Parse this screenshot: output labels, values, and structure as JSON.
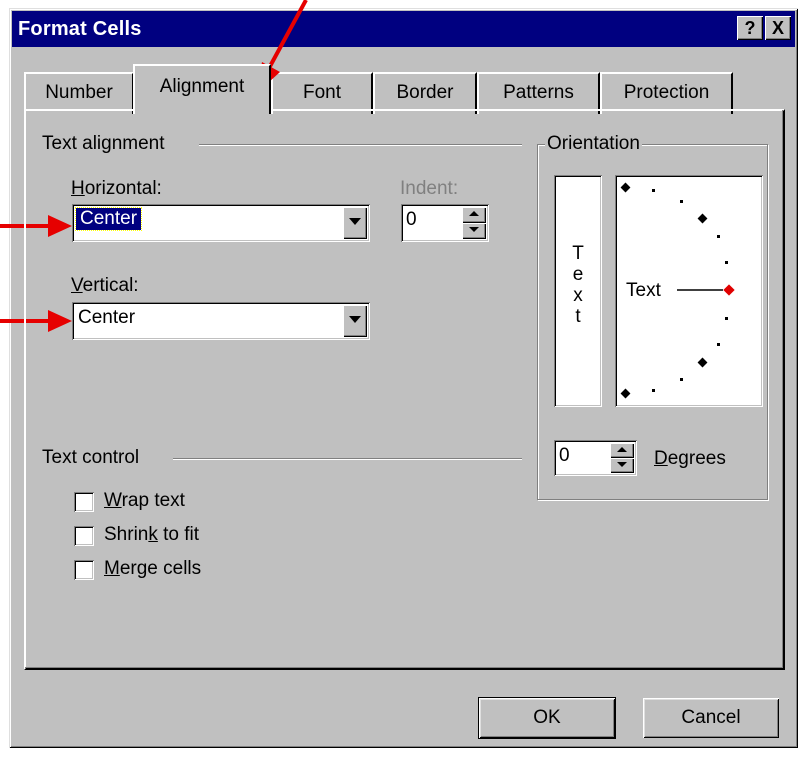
{
  "window": {
    "title": "Format Cells",
    "help_label": "?",
    "close_label": "X"
  },
  "tabs": [
    {
      "label": "Number"
    },
    {
      "label": "Alignment"
    },
    {
      "label": "Font"
    },
    {
      "label": "Border"
    },
    {
      "label": "Patterns"
    },
    {
      "label": "Protection"
    }
  ],
  "text_alignment": {
    "group_label": "Text alignment",
    "horizontal": {
      "label_first": "H",
      "label_rest": "orizontal:",
      "value": "Center"
    },
    "vertical": {
      "label_first": "V",
      "label_rest": "ertical:",
      "value": "Center"
    },
    "indent": {
      "label": "Indent:",
      "value": "0"
    }
  },
  "orientation": {
    "group_label": "Orientation",
    "vertical_text_letters": [
      "T",
      "e",
      "x",
      "t"
    ],
    "dial_text": "Text",
    "degrees_value": "0",
    "degrees_label_first": "D",
    "degrees_label_rest": "egrees"
  },
  "text_control": {
    "group_label": "Text control",
    "wrap": {
      "mn": "W",
      "rest": "rap text",
      "checked": false
    },
    "shrink": {
      "pre": "Shrin",
      "mn": "k",
      "post": " to fit",
      "checked": false
    },
    "merge": {
      "mn": "M",
      "rest": "erge cells",
      "checked": false
    }
  },
  "buttons": {
    "ok": "OK",
    "cancel": "Cancel"
  },
  "colors": {
    "title_bar": "#000080",
    "dialog_face": "#c0c0c0",
    "selection": "#000080",
    "annotation_arrow": "#e60000",
    "dial_marker_active": "#e00000"
  },
  "annotations": [
    "arrow-to-alignment-tab",
    "arrow-to-horizontal-combo",
    "arrow-to-vertical-combo"
  ]
}
